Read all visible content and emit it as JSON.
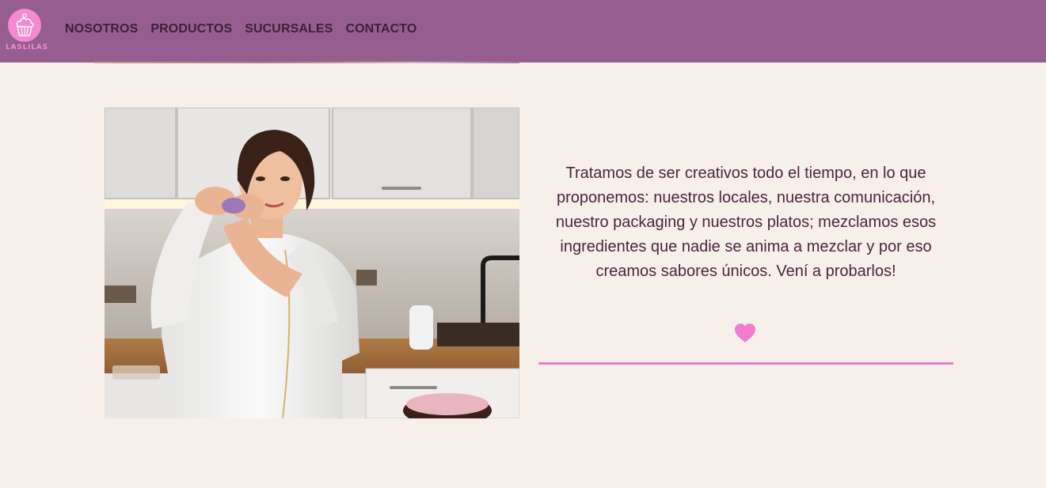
{
  "brand": {
    "logo_text": "LASLILAS",
    "logo_icon": "cupcake-icon"
  },
  "nav": {
    "items": [
      {
        "label": "NOSOTROS"
      },
      {
        "label": "PRODUCTOS"
      },
      {
        "label": "SUCURSALES"
      },
      {
        "label": "CONTACTO"
      }
    ]
  },
  "about": {
    "text": "Tratamos de ser creativos todo el tiempo, en lo que proponemos: nuestros locales, nuestra comunicación, nuestro packaging y nuestros platos; mezclamos esos ingredientes que nadie se anima a mezclar y por eso creamos sabores únicos. Vení a probarlos!",
    "icon": "heart-icon"
  },
  "colors": {
    "navbar": "#955e8f",
    "page_background": "#f7efe9",
    "accent_pink": "#ef7ccd",
    "text": "#4a2541",
    "nav_text": "#3d1f37"
  }
}
